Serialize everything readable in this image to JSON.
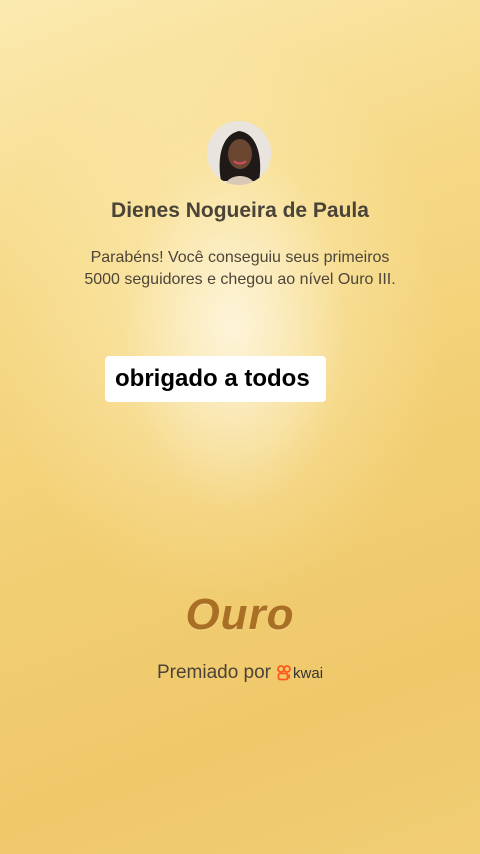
{
  "profile": {
    "name": "Dienes Nogueira de Paula",
    "avatar_icon": "user-avatar-photo"
  },
  "message": {
    "line1": "Parabéns! Você conseguiu seus primeiros",
    "line2": "5000 seguidores e chegou ao nível Ouro III."
  },
  "caption": {
    "text": "obrigado a todos"
  },
  "level": {
    "title": "Ouro",
    "color": "#a96f24"
  },
  "award": {
    "label": "Premiado por",
    "brand": "kwai",
    "brand_color": "#ff5a1f",
    "brand_icon": "kwai-logo-icon"
  }
}
